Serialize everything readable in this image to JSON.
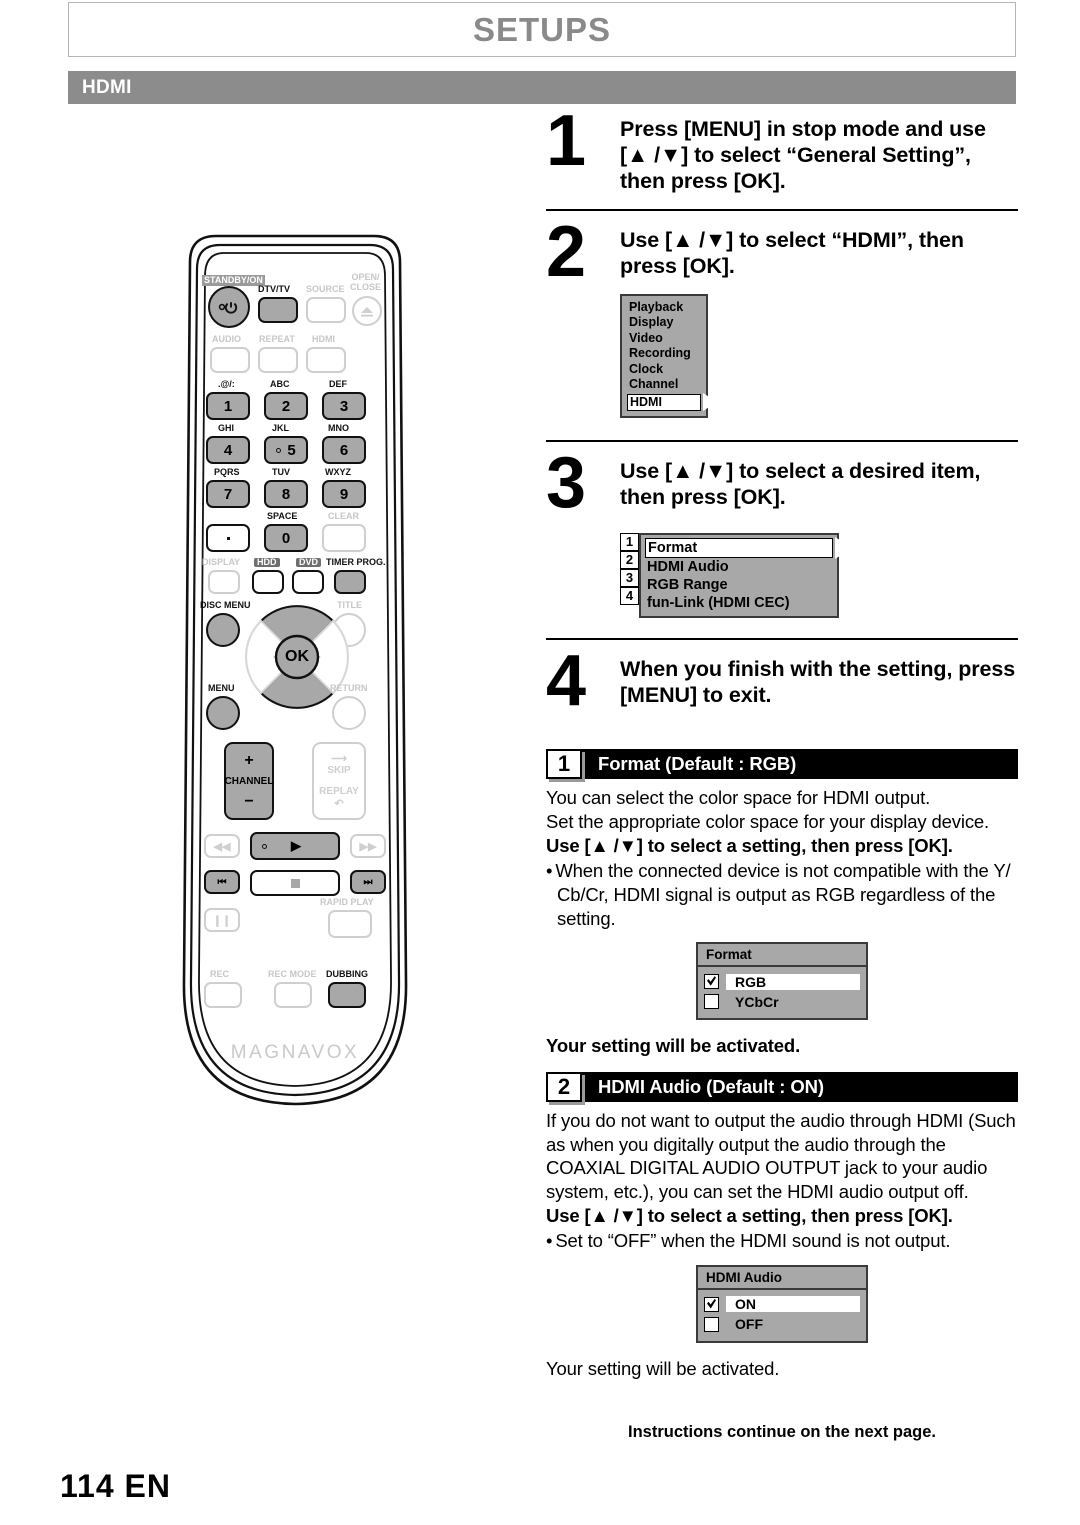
{
  "header": {
    "title": "SETUPS",
    "section": "HDMI"
  },
  "steps": [
    {
      "num": "1",
      "text": "Press [MENU] in stop mode and use [▲ /▼] to select “General Setting”, then press [OK]."
    },
    {
      "num": "2",
      "text": "Use [▲ /▼] to select “HDMI”, then press [OK]."
    },
    {
      "num": "3",
      "text": "Use [▲ /▼] to select a desired item, then press [OK]."
    },
    {
      "num": "4",
      "text": "When you finish with the setting, press [MENU] to exit."
    }
  ],
  "osd_general_menu": {
    "items": [
      "Playback",
      "Display",
      "Video",
      "Recording",
      "Clock",
      "Channel"
    ],
    "selected": "HDMI"
  },
  "osd_hdmi_menu": {
    "badges": [
      "1",
      "2",
      "3",
      "4"
    ],
    "items": [
      "Format",
      "HDMI Audio",
      "RGB Range",
      "fun-Link (HDMI CEC)"
    ],
    "selected_index": 0
  },
  "sections": [
    {
      "badge": "1",
      "title": "Format (Default : RGB)",
      "lines": [
        "You can select the color space for HDMI output.",
        "Set the appropriate color space for your display device."
      ],
      "bold_line": "Use [▲ /▼] to select a setting, then press [OK].",
      "bullet": "When the connected device is not compatible with the Y/ Cb/Cr, HDMI signal is output as RGB regardless of the setting.",
      "dialog": {
        "title": "Format",
        "options": [
          {
            "label": "RGB",
            "checked": true,
            "selected": true
          },
          {
            "label": "YCbCr",
            "checked": false,
            "selected": false
          }
        ]
      },
      "after": "Your setting will be activated."
    },
    {
      "badge": "2",
      "title": "HDMI Audio (Default : ON)",
      "lines": [
        "If you do not want to output the audio through HDMI (Such as when you digitally output the audio through the COAXIAL DIGITAL AUDIO OUTPUT jack to your audio system, etc.), you can set the HDMI audio output off."
      ],
      "bold_line": "Use [▲ /▼] to select a setting, then press [OK].",
      "bullet": "Set to “OFF” when the HDMI sound is not output.",
      "dialog": {
        "title": "HDMI Audio",
        "options": [
          {
            "label": "ON",
            "checked": true,
            "selected": true
          },
          {
            "label": "OFF",
            "checked": false,
            "selected": false
          }
        ]
      },
      "after": "Your setting will be activated."
    }
  ],
  "footnote": "Instructions continue on the next page.",
  "page_number": "114  EN",
  "remote": {
    "brand": "MAGNAVOX",
    "labels": {
      "standby": "STANDBY/ON",
      "dtvtv": "DTV/TV",
      "source": "SOURCE",
      "open_close": "OPEN/ CLOSE",
      "audio": "AUDIO",
      "repeat": "REPEAT",
      "hdmi": "HDMI",
      "k1_top": ".@/:",
      "k2_top": "ABC",
      "k3_top": "DEF",
      "k4_top": "GHI",
      "k5_top": "JKL",
      "k6_top": "MNO",
      "k7_top": "PQRS",
      "k8_top": "TUV",
      "k9_top": "WXYZ",
      "k0_top": "SPACE",
      "clear": "CLEAR",
      "display": "DISPLAY",
      "hdd": "HDD",
      "dvd": "DVD",
      "timer_prog": "TIMER PROG.",
      "disc_menu": "DISC MENU",
      "title": "TITLE",
      "menu": "MENU",
      "return": "RETURN",
      "ok": "OK",
      "channel": "CHANNEL",
      "plus": "+",
      "minus": "−",
      "skip": "SKIP",
      "replay": "REPLAY",
      "rapid_play": "RAPID PLAY",
      "rec": "REC",
      "rec_mode": "REC MODE",
      "dubbing": "DUBBING",
      "n1": "1",
      "n2": "2",
      "n3": "3",
      "n4": "4",
      "n5": "5",
      "n6": "6",
      "n7": "7",
      "n8": "8",
      "n9": "9",
      "n0": "0"
    }
  }
}
